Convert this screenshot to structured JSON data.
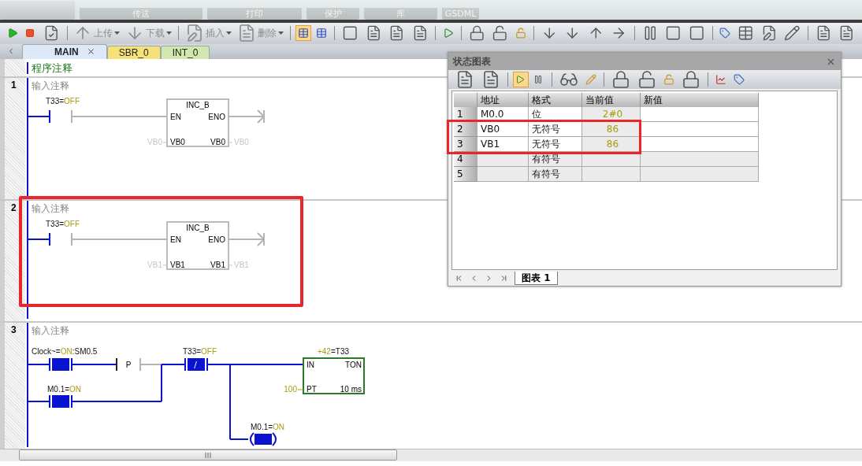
{
  "ribbon": {
    "groups": [
      "传送",
      "打印",
      "保护",
      "库",
      "GSDML"
    ]
  },
  "toolbar": {
    "text_buttons": [
      {
        "label": "上传",
        "disabled": true
      },
      {
        "label": "下载",
        "disabled": true
      },
      {
        "label": "插入",
        "disabled": true
      },
      {
        "label": "删除",
        "disabled": true
      }
    ],
    "monitor_toggles": [
      {
        "selected": true
      },
      {
        "selected": false
      }
    ]
  },
  "tabs": [
    {
      "label": "MAIN",
      "selected": true,
      "closable": true,
      "color": "#dde9f8"
    },
    {
      "label": "SBR_0",
      "selected": false,
      "closable": false,
      "color": "#f6e07a"
    },
    {
      "label": "INT_0",
      "selected": false,
      "closable": false,
      "color": "#d3e6ad"
    }
  ],
  "program_comment": "程序注释",
  "networks": [
    {
      "number": "1",
      "comment": "输入注释",
      "kind": "inc",
      "highlighted": false,
      "contact": {
        "label": "T33=",
        "value": "OFF",
        "energized": false
      },
      "block": {
        "name": "INC_B",
        "en": "EN",
        "eno": "ENO",
        "in_pin": "VB0",
        "out_pin": "VB0",
        "in_operand": "VB0",
        "out_operand": "VB0"
      }
    },
    {
      "number": "2",
      "comment": "输入注释",
      "kind": "inc",
      "highlighted": true,
      "contact": {
        "label": "T33=",
        "value": "OFF",
        "energized": false
      },
      "block": {
        "name": "INC_B",
        "en": "EN",
        "eno": "ENO",
        "in_pin": "VB1",
        "out_pin": "VB1",
        "in_operand": "VB1",
        "out_operand": "VB1"
      }
    },
    {
      "number": "3",
      "comment": "输入注释",
      "kind": "timer",
      "highlighted": false,
      "clock_contact": {
        "label": "Clock~=",
        "value": "ON",
        "suffix": ":SM0.5",
        "energized": true
      },
      "edge_contact": {
        "label": "P"
      },
      "hold_contact": {
        "label": "M0.1=",
        "value": "ON",
        "energized": true
      },
      "timer_contact": {
        "label": "T33=",
        "value": "OFF",
        "symbol": "/",
        "energized": true
      },
      "timer": {
        "current": "+42",
        "name": "=T33",
        "in": "IN",
        "type": "TON",
        "pt": "PT",
        "base": "10 ms",
        "preset": "100"
      },
      "coil": {
        "label": "M0.1=",
        "value": "ON",
        "energized": true
      }
    }
  ],
  "status_chart": {
    "title": "状态图表",
    "toolbar_toggles": [
      {
        "selected": true
      },
      {
        "selected": false
      }
    ],
    "columns": [
      "地址",
      "格式",
      "当前值",
      "新值"
    ],
    "rows": [
      {
        "index": "1",
        "address": "M0.0",
        "format": "位",
        "current": "2#0",
        "highlighted": false
      },
      {
        "index": "2",
        "address": "VB0",
        "format": "无符号",
        "current": "86",
        "highlighted": true
      },
      {
        "index": "3",
        "address": "VB1",
        "format": "无符号",
        "current": "86",
        "highlighted": true
      },
      {
        "index": "4",
        "format": "有符号",
        "highlighted": false
      },
      {
        "index": "5",
        "format": "有符号",
        "highlighted": false
      }
    ],
    "sheet_tab": "图表 1"
  }
}
